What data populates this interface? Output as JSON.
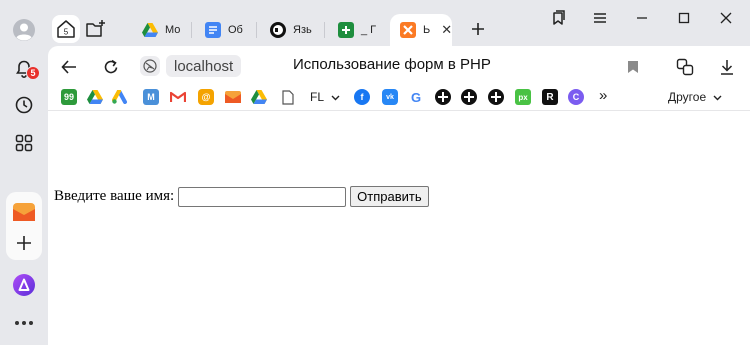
{
  "sidebar": {
    "notification_badge": "5",
    "items": [
      {
        "name": "profile-avatar"
      },
      {
        "name": "notifications"
      },
      {
        "name": "history"
      },
      {
        "name": "services-grid"
      },
      {
        "name": "mail"
      },
      {
        "name": "add"
      },
      {
        "name": "alice-assistant"
      },
      {
        "name": "more"
      }
    ]
  },
  "tabs": {
    "home_badge": "5",
    "items": [
      {
        "label": "Мо",
        "icon": "google-drive-icon"
      },
      {
        "label": "Об",
        "icon": "google-docs-icon"
      },
      {
        "label": "Язь",
        "icon": "php-logo-icon"
      },
      {
        "label": "_ Г",
        "icon": "google-sheets-icon"
      },
      {
        "label": "Ь",
        "icon": "xampp-icon",
        "active": true
      }
    ],
    "new_tab_symbol": "+"
  },
  "navbar": {
    "url": "localhost",
    "page_title": "Использование форм в PHP"
  },
  "bookmarks": {
    "folder_label": "FL",
    "more_symbol": "»",
    "other_label": "Другое",
    "items": [
      {
        "icon": "99-icon",
        "text": "99",
        "color": "#2e9a3b"
      },
      {
        "icon": "google-drive-icon"
      },
      {
        "icon": "google-ads-icon"
      },
      {
        "icon": "moysklad-icon",
        "text": "M",
        "color": "#4a90d9"
      },
      {
        "icon": "gmail-icon"
      },
      {
        "icon": "mail-ru-icon",
        "text": "@",
        "color": "#f4a300"
      },
      {
        "icon": "yandex-mail-icon"
      },
      {
        "icon": "google-drive-icon-2"
      },
      {
        "icon": "file-icon"
      },
      {
        "icon": "facebook-icon",
        "text": "f",
        "color": "#1877f2"
      },
      {
        "icon": "vk-icon",
        "text": "vk",
        "color": "#2787f5"
      },
      {
        "icon": "google-icon",
        "text": "G"
      },
      {
        "icon": "dark-circle-icon-1"
      },
      {
        "icon": "dark-circle-icon-2"
      },
      {
        "icon": "dark-circle-icon-3"
      },
      {
        "icon": "px-icon",
        "text": "px",
        "color": "#49c244"
      },
      {
        "icon": "r-icon",
        "text": "R",
        "color": "#111111"
      },
      {
        "icon": "c-icon",
        "text": "C",
        "color": "#7b5cf0"
      }
    ]
  },
  "form": {
    "label": "Введите ваше имя:",
    "input_value": "",
    "submit_label": "Отправить"
  }
}
